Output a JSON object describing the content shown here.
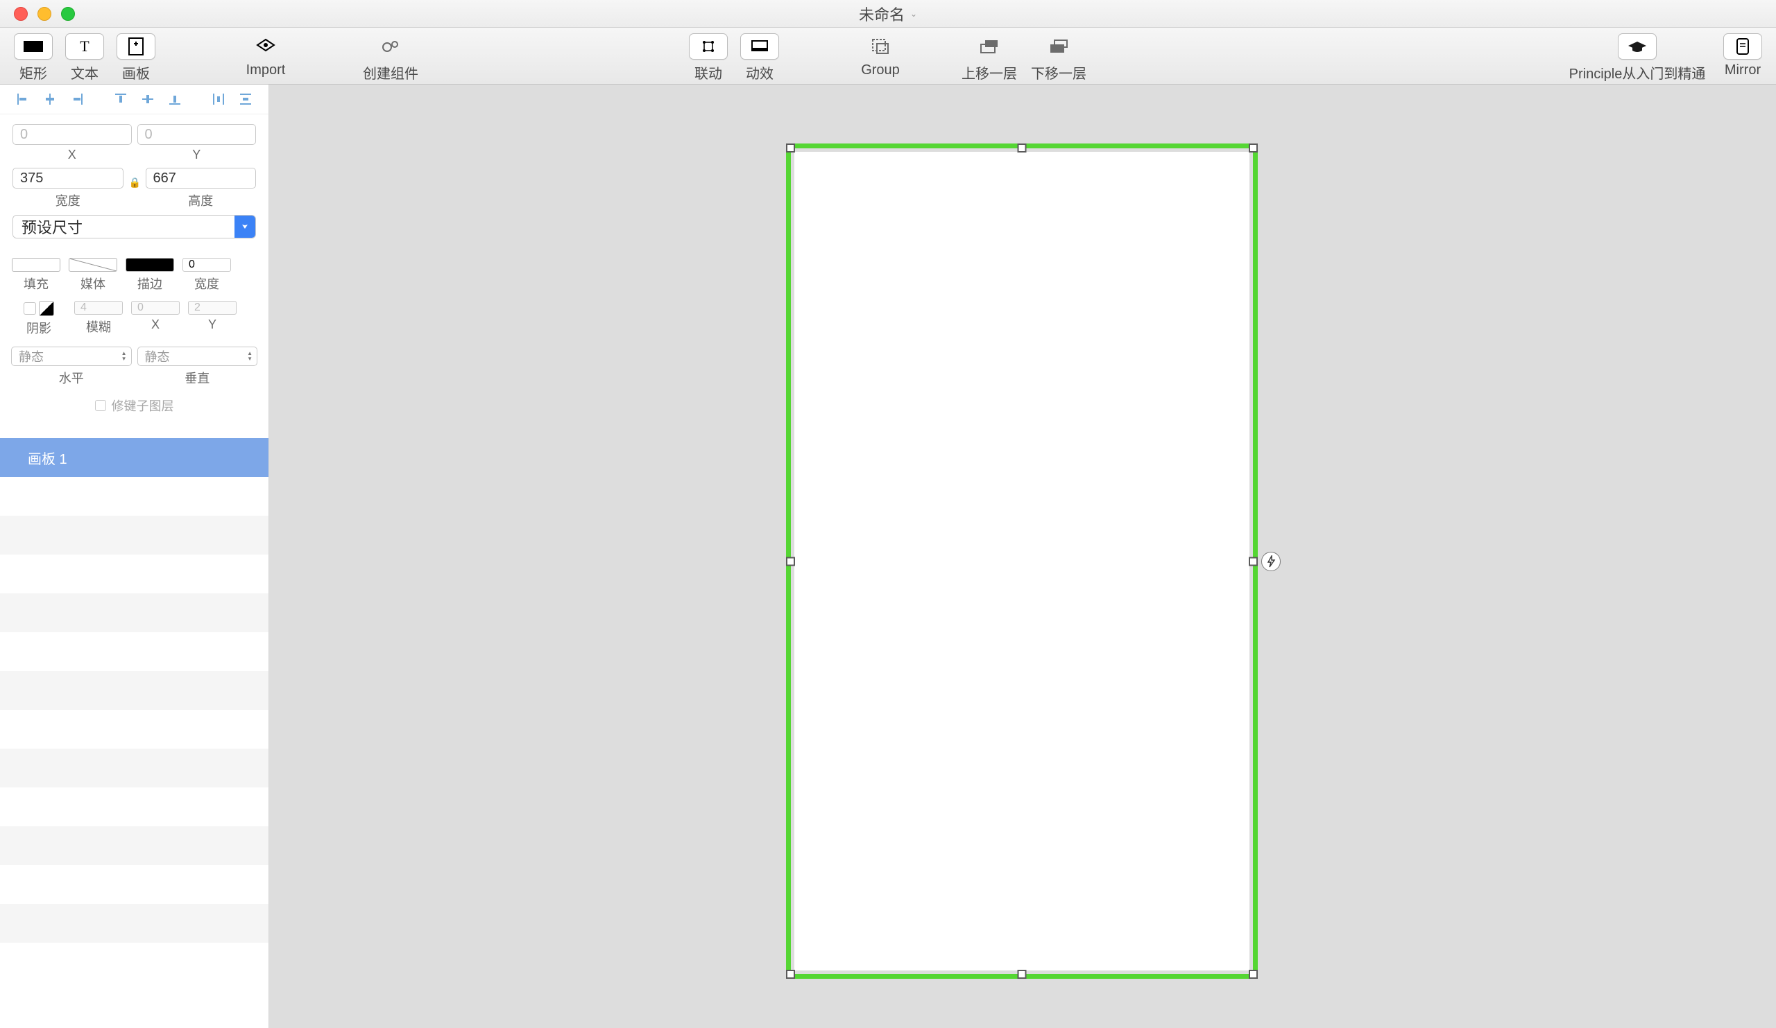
{
  "window": {
    "title": "未命名"
  },
  "toolbar": {
    "rectangle": "矩形",
    "text": "文本",
    "artboard": "画板",
    "import": "Import",
    "create_component": "创建组件",
    "drivers": "联动",
    "animate": "动效",
    "group": "Group",
    "forward": "上移一层",
    "backward": "下移一层",
    "tutorial": "Principle从入门到精通",
    "mirror": "Mirror"
  },
  "inspector": {
    "x": {
      "label": "X",
      "value": "0"
    },
    "y": {
      "label": "Y",
      "value": "0"
    },
    "width": {
      "label": "宽度",
      "value": "375"
    },
    "height": {
      "label": "高度",
      "value": "667"
    },
    "preset": {
      "label": "预设尺寸"
    },
    "fill": "填充",
    "media": "媒体",
    "stroke": "描边",
    "stroke_width_label": "宽度",
    "stroke_width_value": "0",
    "shadow": "阴影",
    "blur": "模糊",
    "blur_value": "4",
    "shadow_x_label": "X",
    "shadow_x_value": "0",
    "shadow_y_label": "Y",
    "shadow_y_value": "2",
    "horizontal": {
      "label": "水平",
      "value": "静态"
    },
    "vertical": {
      "label": "垂直",
      "value": "静态"
    },
    "clip_sublayers": "修键子图层"
  },
  "layers": {
    "selected": "画板 1"
  }
}
